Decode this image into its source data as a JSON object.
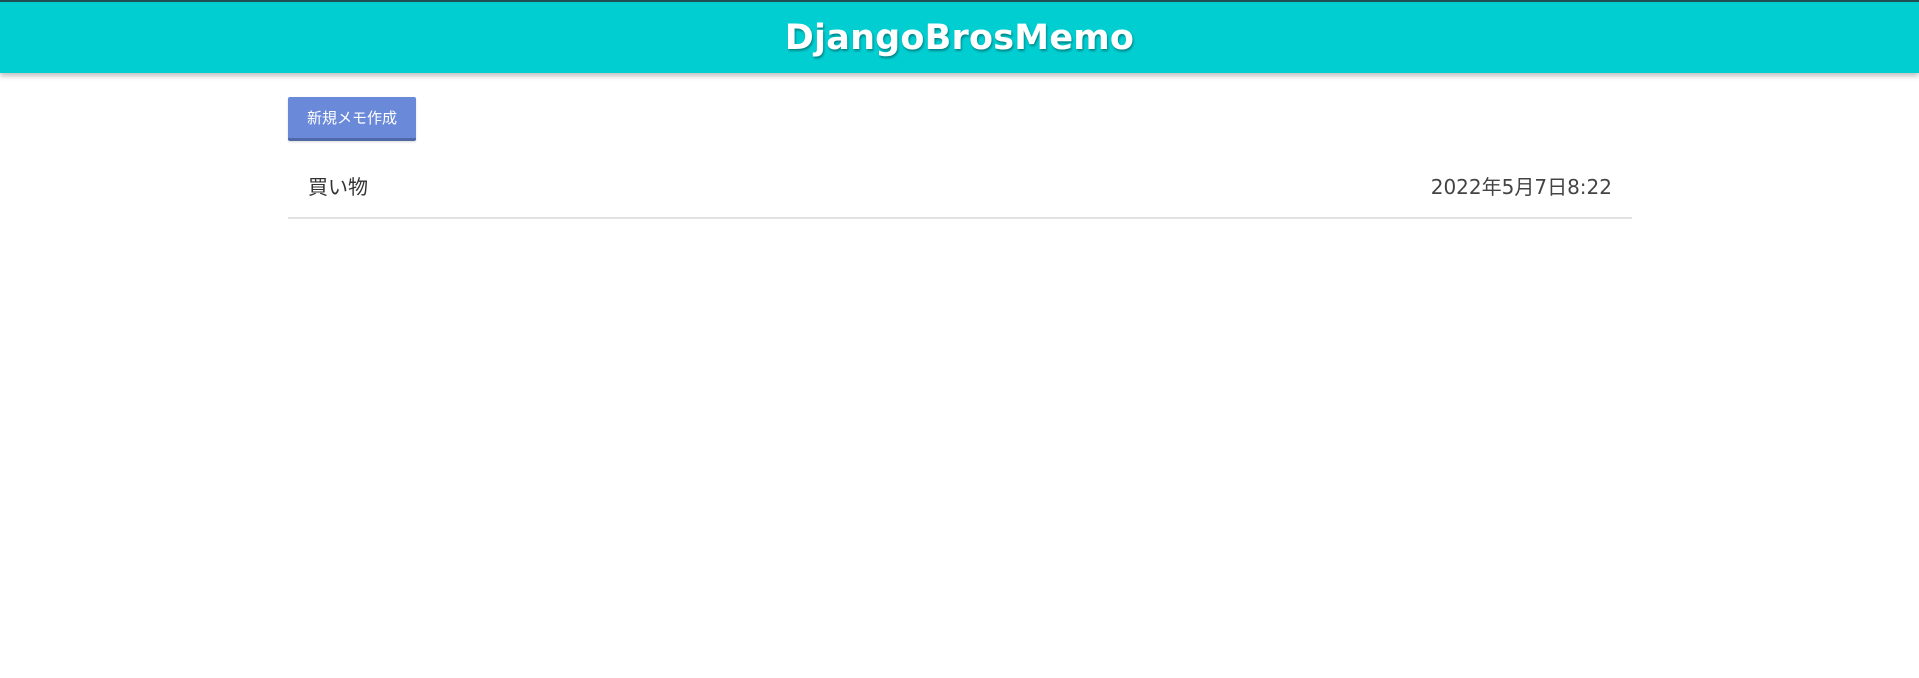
{
  "header": {
    "title": "DjangoBrosMemo"
  },
  "toolbar": {
    "new_memo_label": "新規メモ作成"
  },
  "memos": [
    {
      "title": "買い物",
      "date": "2022年5月7日8:22"
    }
  ],
  "colors": {
    "header_bg": "#00ced1",
    "button_bg": "#6a8ad9",
    "divider": "#e2e2e2"
  }
}
